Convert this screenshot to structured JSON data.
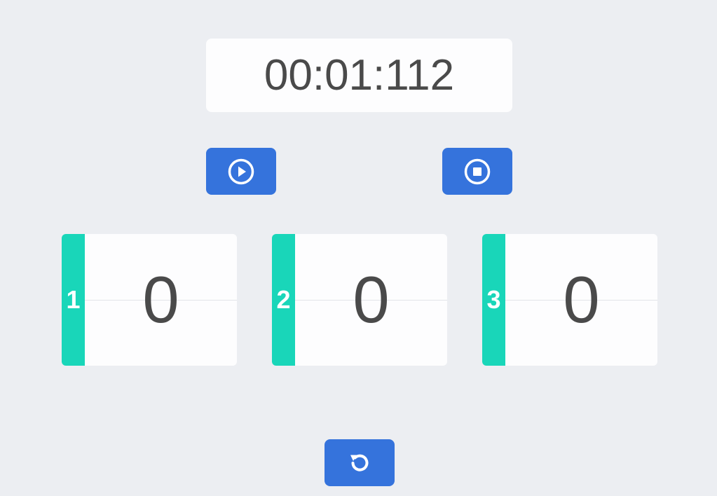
{
  "timer": {
    "display": "00:01:112"
  },
  "controls": {
    "play_icon": "play-circle-icon",
    "stop_icon": "stop-circle-icon",
    "reset_icon": "reset-icon"
  },
  "laps": [
    {
      "index": "1",
      "value": "0"
    },
    {
      "index": "2",
      "value": "0"
    },
    {
      "index": "3",
      "value": "0"
    }
  ],
  "colors": {
    "background": "#eceef2",
    "card": "#fdfdfe",
    "accent_button": "#3573dc",
    "lap_stripe": "#19d6b9",
    "text": "#4a4a4a"
  }
}
